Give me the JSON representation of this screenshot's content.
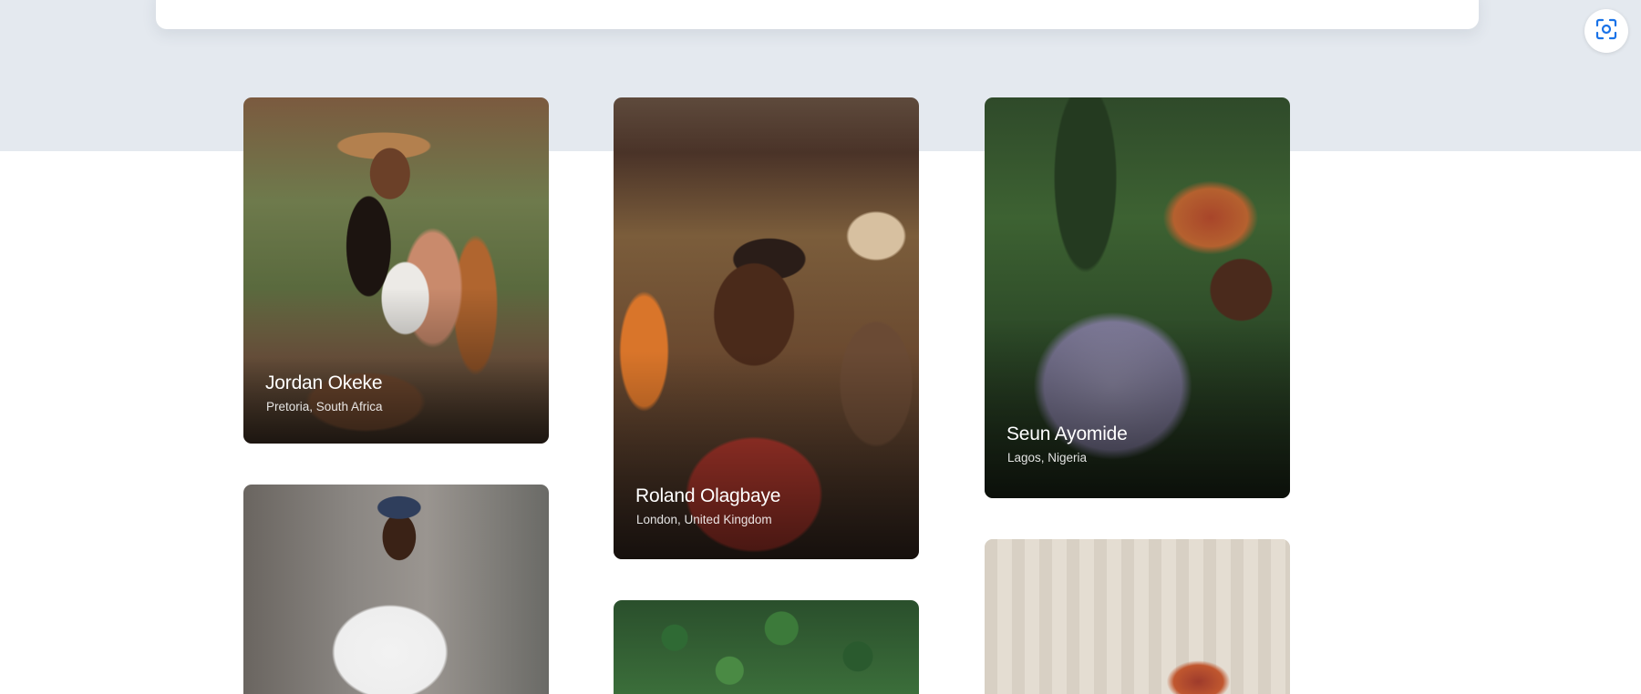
{
  "toolbar": {
    "scan_icon": "scan-icon"
  },
  "profiles": [
    {
      "name": "Jordan Okeke",
      "location": "Pretoria, South Africa"
    },
    {
      "name": "Roland Olagbaye",
      "location": "London, United Kingdom"
    },
    {
      "name": "Seun Ayomide",
      "location": "Lagos, Nigeria"
    },
    {
      "name": "",
      "location": ""
    },
    {
      "name": "",
      "location": ""
    },
    {
      "name": "",
      "location": ""
    }
  ],
  "colors": {
    "top_band": "#e4e9ef",
    "page_background": "#ffffff",
    "scan_icon": "#1a73e8"
  }
}
